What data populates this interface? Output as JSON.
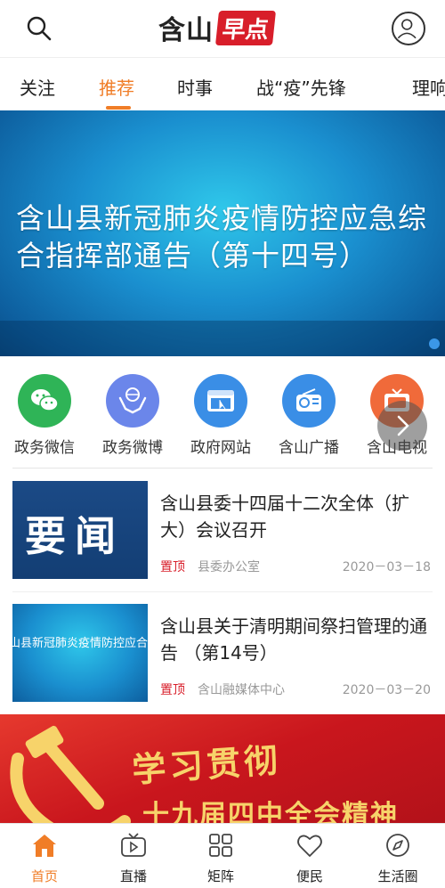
{
  "header": {
    "logo_part1": "含山",
    "logo_part2": "早点",
    "search_icon": "search-icon",
    "profile_icon": "user-icon"
  },
  "tabs": [
    {
      "label": "关注",
      "active": false
    },
    {
      "label": "推荐",
      "active": true
    },
    {
      "label": "时事",
      "active": false
    },
    {
      "label": "战“疫”先锋",
      "active": false
    },
    {
      "label": "理响",
      "active": false
    }
  ],
  "banner": {
    "text": "含山县新冠肺炎疫情防控应急综合指挥部通告（第十四号）"
  },
  "quick_links": [
    {
      "label": "政务微信",
      "icon": "wechat-icon",
      "color": "#2fb457"
    },
    {
      "label": "政务微博",
      "icon": "hands-globe-icon",
      "color": "#5f7fe6"
    },
    {
      "label": "政府网站",
      "icon": "web-browser-icon",
      "color": "#3a8ee6"
    },
    {
      "label": "含山广播",
      "icon": "radio-icon",
      "color": "#3a8ee6"
    },
    {
      "label": "含山电视",
      "icon": "tv-icon",
      "color": "#f06a3a"
    }
  ],
  "news": [
    {
      "title": "含山县委十四届十二次全体（扩大）会议召开",
      "tag": "置顶",
      "source": "县委办公室",
      "date": "2020－03－18",
      "thumb_text": "要闻"
    },
    {
      "title": "含山县关于清明期间祭扫管理的通告 （第14号）",
      "tag": "置顶",
      "source": "含山融媒体中心",
      "date": "2020－03－20",
      "thumb_text": "山县新冠肺炎疫情防控应合指挥部通告（第十四号"
    }
  ],
  "promo": {
    "line1": "学习贯彻",
    "line2": "十九届四中全会精神"
  },
  "bottom_nav": [
    {
      "label": "首页",
      "icon": "home-icon",
      "active": true
    },
    {
      "label": "直播",
      "icon": "tv-play-icon",
      "active": false
    },
    {
      "label": "矩阵",
      "icon": "grid-icon",
      "active": false
    },
    {
      "label": "便民",
      "icon": "heart-icon",
      "active": false
    },
    {
      "label": "生活圈",
      "icon": "compass-icon",
      "active": false
    }
  ],
  "colors": {
    "accent": "#f07d27",
    "brand_red": "#d81e2a"
  }
}
